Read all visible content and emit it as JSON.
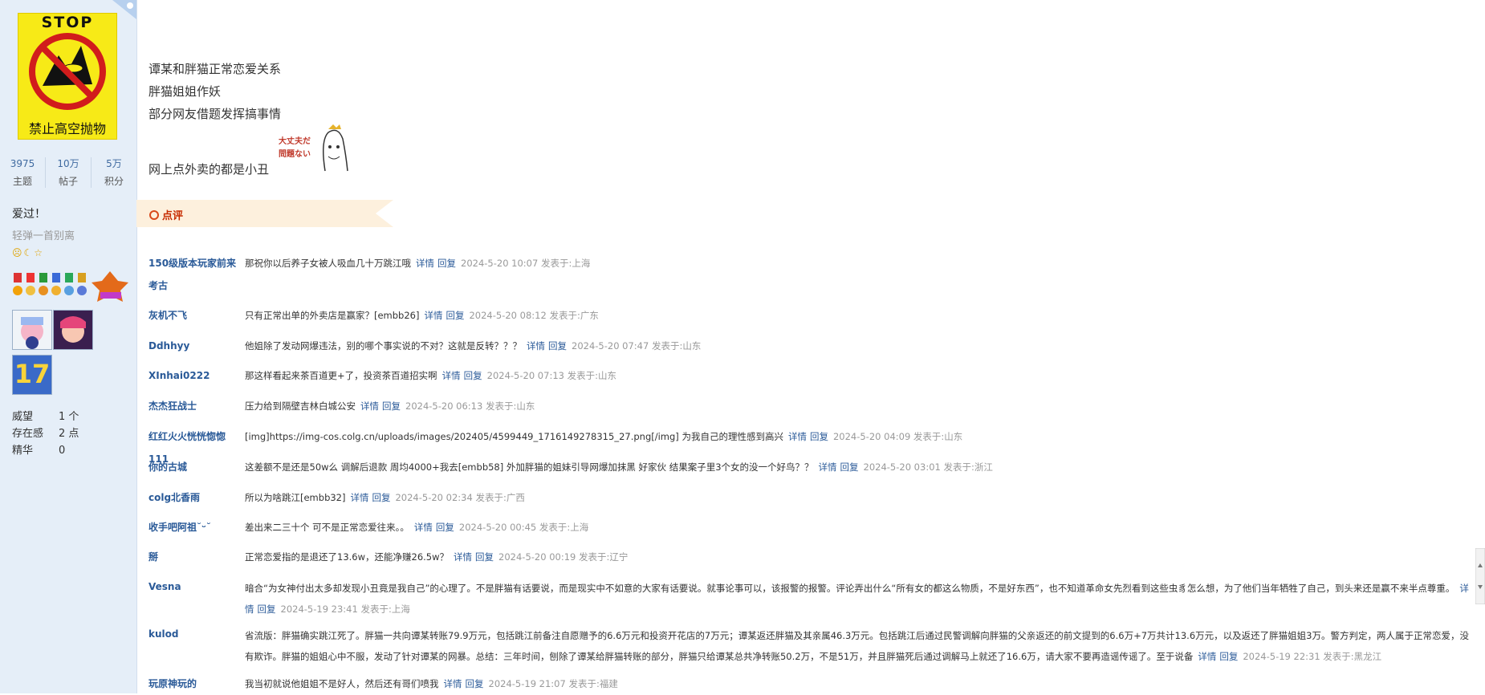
{
  "sidebar": {
    "avatar_text": "禁止高空抛物",
    "avatar_top": "STOP",
    "stats": [
      {
        "num": "3975",
        "label": "主题"
      },
      {
        "num": "10万",
        "label": "帖子"
      },
      {
        "num": "5万",
        "label": "积分"
      }
    ],
    "username": "爱过！",
    "signature": "轻弹一首别离",
    "level_icons": "☹☾☆",
    "user_stats": [
      {
        "key": "威望",
        "value": "1 个"
      },
      {
        "key": "存在感",
        "value": "2 点"
      },
      {
        "key": "精华",
        "value": "0"
      }
    ],
    "badge_level": "17"
  },
  "post": {
    "lines": [
      "谭某和胖猫正常恋爱关系",
      "胖猫姐姐作妖",
      "部分网友借题发挥搞事情"
    ],
    "last_line": "网上点外卖的都是小丑",
    "sticker_text": [
      "大丈夫だ",
      "問題ない"
    ]
  },
  "review": {
    "title": "点评"
  },
  "comments": [
    {
      "name": "150级版本玩家前来考古",
      "text": "那祝你以后养子女被人吸血几十万跳江哦",
      "detail": "详情",
      "reply": "回复",
      "meta": "2024-5-20 10:07 发表于:上海"
    },
    {
      "name": "灰机不飞",
      "text": "只有正常出单的外卖店是赢家？[embb26]",
      "detail": "详情",
      "reply": "回复",
      "meta": "2024-5-20 08:12 发表于:广东"
    },
    {
      "name": "Ddhhyy",
      "text": "他姐除了发动网爆违法，别的哪个事实说的不对？这就是反转？？？",
      "detail": "详情",
      "reply": "回复",
      "meta": "2024-5-20 07:47 发表于:山东"
    },
    {
      "name": "XInhai0222",
      "text": "那这样看起来茶百道更+了，投资茶百道招实啊",
      "detail": "详情",
      "reply": "回复",
      "meta": "2024-5-20 07:13 发表于:山东"
    },
    {
      "name": "杰杰狂战士",
      "text": "压力给到隔壁吉林白城公安",
      "detail": "详情",
      "reply": "回复",
      "meta": "2024-5-20 06:13 发表于:山东"
    },
    {
      "name": "红红火火恍恍惚惚111",
      "text": "[img]https://img-cos.colg.cn/uploads/images/202405/4599449_1716149278315_27.png[/img] 为我自己的理性感到高兴",
      "detail": "详情",
      "reply": "回复",
      "meta": "2024-5-20 04:09 发表于:山东"
    },
    {
      "name": "你的古城",
      "text": "这差额不是还是50w么 调解后退款 周均4000+我去[embb58] 外加胖猫的姐妹引导网爆加抹黑 好家伙 结果案子里3个女的没一个好鸟？？",
      "detail": "详情",
      "reply": "回复",
      "meta": "2024-5-20 03:01 发表于:浙江"
    },
    {
      "name": "colg北香雨",
      "text": "所以为啥跳江[embb32]",
      "detail": "详情",
      "reply": "回复",
      "meta": "2024-5-20 02:34 发表于:广西"
    },
    {
      "name": "收手吧阿祖˘ᵕ˘",
      "text": "差出来二三十个 可不是正常恋爱往来。。",
      "detail": "详情",
      "reply": "回复",
      "meta": "2024-5-20 00:45 发表于:上海"
    },
    {
      "name": "掰",
      "text": "正常恋爱指的是退还了13.6w，还能净赚26.5w？",
      "detail": "详情",
      "reply": "回复",
      "meta": "2024-5-20 00:19 发表于:辽宁"
    },
    {
      "name": "Vesna",
      "text": "暗合“为女神付出太多却发现小丑竟是我自己”的心理了。不是胖猫有话要说，而是现实中不如意的大家有话要说。就事论事可以，该报警的报警。评论弄出什么“所有女的都这么物质，不是好东西”，也不知道革命女先烈看到这些虫豸怎么想，为了他们当年牺牲了自己，到头来还是赢不来半点尊重。",
      "detail": "详情",
      "reply": "回复",
      "meta": "2024-5-19 23:41 发表于:上海"
    },
    {
      "name": "kulod",
      "text": "省流版：胖猫确实跳江死了。胖猫一共向谭某转账79.9万元，包括跳江前备注自愿赠予的6.6万元和投资开花店的7万元；谭某返还胖猫及其亲属46.3万元。包括跳江后通过民警调解向胖猫的父亲返还的前文提到的6.6万+7万共计13.6万元，以及返还了胖猫姐姐3万。警方判定，两人属于正常恋爱，没有欺诈。胖猫的姐姐心中不服，发动了针对谭某的网暴。总结：三年时间，刨除了谭某给胖猫转账的部分，胖猫只给谭某总共净转账50.2万，不是51万，并且胖猫死后通过调解马上就还了16.6万，请大家不要再造谣传谣了。至于说备",
      "detail": "详情",
      "reply": "回复",
      "meta": "2024-5-19 22:31 发表于:黑龙江"
    },
    {
      "name": "玩原神玩的",
      "text": "我当初就说他姐姐不是好人，然后还有哥们喷我",
      "detail": "详情",
      "reply": "回复",
      "meta": "2024-5-19 21:07 发表于:福建"
    }
  ]
}
